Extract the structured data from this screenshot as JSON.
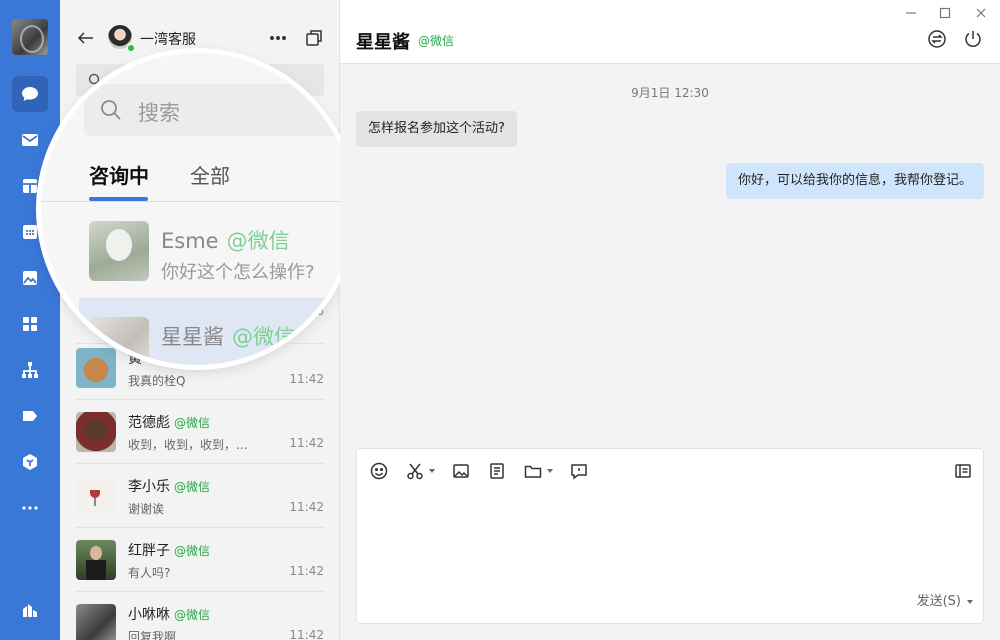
{
  "agent": {
    "name": "一湾客服"
  },
  "list": {
    "search_placeholder": "搜索",
    "tabs": [
      {
        "label": "咨询中"
      },
      {
        "label": "全部"
      }
    ],
    "items": [
      {
        "name": "Esme",
        "source": "@微信",
        "message": "你好这个怎么操作?",
        "time": ""
      },
      {
        "name": "星星酱",
        "source": "@微信",
        "message": "",
        "time": ""
      },
      {
        "name": "黄",
        "source": "",
        "message": "我真的栓Q",
        "time": "11:42"
      },
      {
        "name": "范德彪",
        "source": "@微信",
        "message": "收到，收到，收到，...",
        "time": "11:42"
      },
      {
        "name": "李小乐",
        "source": "@微信",
        "message": "谢谢诶",
        "time": "11:42"
      },
      {
        "name": "红胖子",
        "source": "@微信",
        "message": "有人吗?",
        "time": "11:42"
      },
      {
        "name": "小咻咻",
        "source": "@微信",
        "message": "回复我啊",
        "time": "11:42"
      }
    ],
    "partial_time": "6"
  },
  "chat": {
    "title": "星星酱",
    "source": "@微信",
    "date_label": "9月1日 12:30",
    "messages": [
      {
        "direction": "in",
        "text": "怎样报名参加这个活动?"
      },
      {
        "direction": "out",
        "text": "你好，可以给我你的信息，我帮你登记。"
      }
    ],
    "send_label": "发送(S)"
  },
  "colors": {
    "rail": "#3a78d8",
    "accent": "#3a78d8",
    "source_green": "#23a845",
    "bubble_out": "#cfe5fb",
    "bubble_in": "#e3e3e3"
  },
  "icons": [
    "message-icon",
    "mail-icon",
    "box-icon",
    "calendar-icon",
    "image-icon",
    "grid-icon",
    "org-icon",
    "tag-icon",
    "cube-icon",
    "more-icon",
    "stats-icon"
  ]
}
